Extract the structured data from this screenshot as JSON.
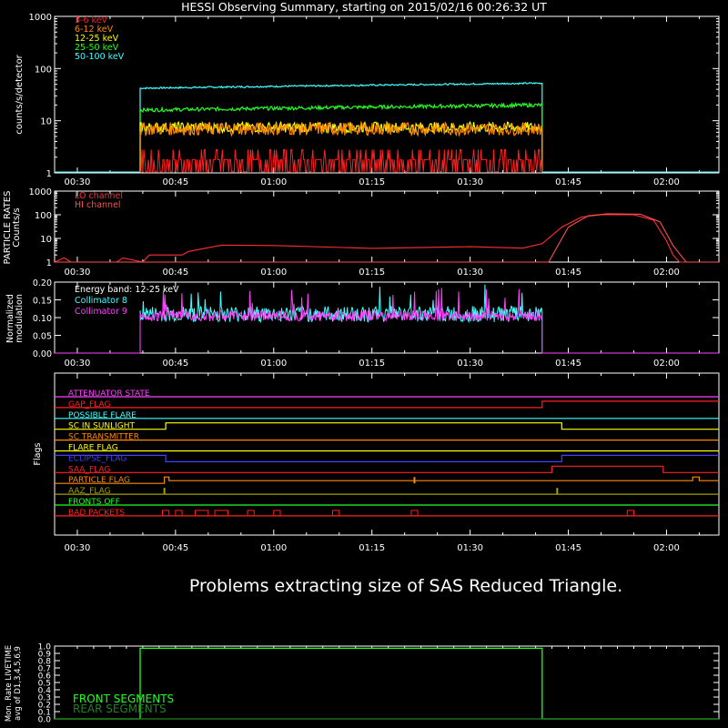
{
  "title": "HESSI Observing Summary, starting on 2015/02/16 00:26:32 UT",
  "colors": {
    "bg": "#000000",
    "axis": "#ffffff",
    "red": "#ff2020",
    "orange": "#ff8a00",
    "yellow": "#ffff00",
    "green": "#20ff20",
    "cyan": "#40ffff",
    "lo": "#ff3030",
    "hi": "#ff5050",
    "collimator8": "#40ffff",
    "collimator9": "#ff40ff",
    "front": "#20ff20",
    "rear": "#208020"
  },
  "time_ticks": [
    "00:30",
    "00:45",
    "01:00",
    "01:15",
    "01:30",
    "01:45",
    "02:00"
  ],
  "time_tick_minutes": [
    30,
    45,
    60,
    75,
    90,
    105,
    120
  ],
  "time_range_minutes": [
    26.53,
    128
  ],
  "panels": {
    "count_rates": {
      "ylabel": "counts/s/detector",
      "yticks": [
        "1",
        "10",
        "100",
        "1000"
      ],
      "legend": [
        "3-6 keV",
        "6-12 keV",
        "12-25 keV",
        "25-50 keV",
        "50-100 keV"
      ],
      "legend_colors": [
        "#ff2020",
        "#ff8a00",
        "#ffff00",
        "#20ff20",
        "#40ffff"
      ]
    },
    "particle": {
      "ylabel1": "PARTICLE RATES",
      "ylabel2": "Counts/s",
      "yticks": [
        "1",
        "10",
        "100",
        "1000"
      ],
      "legend": [
        "LO channel",
        "HI channel"
      ]
    },
    "modulation": {
      "ylabel1": "Normalized",
      "ylabel2": "modulation",
      "yticks": [
        "0.00",
        "0.05",
        "0.10",
        "0.15",
        "0.20"
      ],
      "legend": [
        "Energy band: 12-25 keV",
        "Collimator 8",
        "Collimator 9"
      ]
    },
    "flags": {
      "ylabel": "Flags",
      "labels": [
        "ATTENUATOR STATE",
        "GAP_FLAG",
        "POSSIBLE FLARE",
        "SC IN SUNLIGHT",
        "SC TRANSMITTER",
        "FLARE FLAG",
        "ECLIPSE_FLAG",
        "SAA_FLAG",
        "PARTICLE FLAG",
        "AAZ_FLAG",
        "FRONTS OFF",
        "BAD PACKETS"
      ],
      "label_colors": [
        "#ff40ff",
        "#ff2020",
        "#40ffff",
        "#ffff00",
        "#ff8a00",
        "#ffff00",
        "#4040ff",
        "#ff2020",
        "#ff8a00",
        "#a0a000",
        "#20ff20",
        "#ff2020"
      ]
    },
    "message": "Problems extracting size of SAS Reduced Triangle.",
    "livetime": {
      "ylabel1": "Mon. Rate LIVETIME",
      "ylabel2": "avg of D1,3,4,5,6,9",
      "yticks": [
        "0.0",
        "0.1",
        "0.2",
        "0.3",
        "0.4",
        "0.5",
        "0.6",
        "0.7",
        "0.8",
        "0.9",
        "1.0"
      ],
      "legend": [
        "FRONT SEGMENTS",
        "REAR SEGMENTS"
      ]
    }
  },
  "chart_data": [
    {
      "type": "line",
      "title": "HESSI Observing Summary, starting on 2015/02/16 00:26:32 UT",
      "ylabel": "counts/s/detector",
      "yscale": "log",
      "ylim": [
        1,
        1000
      ],
      "xlim_minutes": [
        26.53,
        128
      ],
      "data_window_minutes": [
        39.6,
        101
      ],
      "series": [
        {
          "name": "3-6 keV",
          "approx_level": 1.8
        },
        {
          "name": "6-12 keV",
          "approx_level": 7
        },
        {
          "name": "12-25 keV",
          "approx_level": 7.5
        },
        {
          "name": "25-50 keV",
          "approx_level": 16
        },
        {
          "name": "50-100 keV",
          "approx_level": 42
        }
      ]
    },
    {
      "type": "line",
      "ylabel": "Counts/s",
      "yscale": "log",
      "ylim": [
        1,
        1000
      ],
      "series": [
        {
          "name": "LO channel",
          "points": [
            [
              26.53,
              1
            ],
            [
              28,
              1.5
            ],
            [
              29,
              1
            ],
            [
              36,
              1
            ],
            [
              37,
              1.5
            ],
            [
              40,
              1
            ],
            [
              41,
              2
            ],
            [
              46,
              2
            ],
            [
              47,
              3
            ],
            [
              52,
              5
            ],
            [
              60,
              5
            ],
            [
              75,
              4
            ],
            [
              90,
              4
            ],
            [
              98,
              4
            ],
            [
              101,
              6
            ],
            [
              104,
              30
            ],
            [
              107,
              80
            ],
            [
              110,
              100
            ],
            [
              115,
              100
            ],
            [
              118,
              60
            ],
            [
              120,
              8
            ],
            [
              121,
              2
            ],
            [
              122,
              1
            ],
            [
              128,
              1
            ]
          ]
        },
        {
          "name": "HI channel",
          "points": [
            [
              26.53,
              1
            ],
            [
              102,
              1
            ],
            [
              105,
              30
            ],
            [
              108,
              90
            ],
            [
              111,
              110
            ],
            [
              116,
              105
            ],
            [
              119,
              50
            ],
            [
              121,
              5
            ],
            [
              123,
              1
            ],
            [
              128,
              1
            ]
          ]
        }
      ]
    },
    {
      "type": "line",
      "ylabel": "Normalized modulation",
      "ylim": [
        0,
        0.2
      ],
      "series": [
        {
          "name": "Collimator 8",
          "approx_level": 0.11
        },
        {
          "name": "Collimator 9",
          "approx_level": 0.105
        }
      ]
    },
    {
      "type": "line",
      "ylabel": "Mon. Rate LIVETIME avg of D1,3,4,5,6,9",
      "ylim": [
        0,
        1.0
      ],
      "series": [
        {
          "name": "FRONT SEGMENTS",
          "points": [
            [
              26.53,
              0
            ],
            [
              39.6,
              0
            ],
            [
              39.6,
              0.97
            ],
            [
              101,
              0.97
            ],
            [
              101,
              0
            ],
            [
              128,
              0
            ]
          ]
        },
        {
          "name": "REAR SEGMENTS",
          "points": [
            [
              26.53,
              0
            ],
            [
              128,
              0
            ]
          ]
        }
      ]
    }
  ]
}
